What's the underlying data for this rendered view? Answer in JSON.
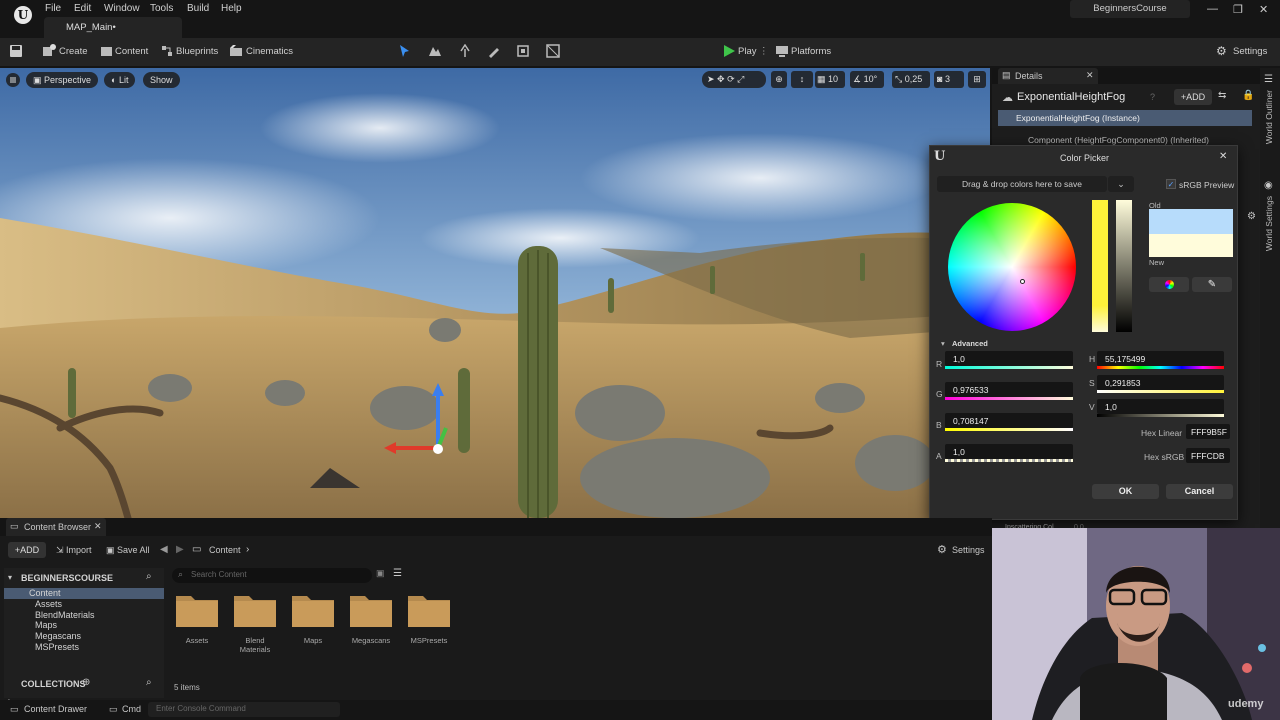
{
  "app": {
    "logo": "U",
    "project": "BeginnersCourse",
    "map_tab": "MAP_Main•"
  },
  "menu": [
    "File",
    "Edit",
    "Window",
    "Tools",
    "Build",
    "Help"
  ],
  "window_controls": [
    "—",
    "❐",
    "✕"
  ],
  "toolbar": {
    "create": "Create",
    "content": "Content",
    "blueprints": "Blueprints",
    "cinematics": "Cinematics",
    "play": "Play",
    "platforms": "Platforms",
    "settings": "Settings"
  },
  "viewport": {
    "perspective": "Perspective",
    "lit": "Lit",
    "show": "Show",
    "grid": "10",
    "angle": "10°",
    "scale": "0,25",
    "camera": "3"
  },
  "details": {
    "tab": "Details",
    "actor": "ExponentialHeightFog",
    "add": "ADD",
    "instance": "ExponentialHeightFog (Instance)",
    "component": "Component (HeightFogComponent0) (Inherited)",
    "inscattering_label": "Inscattering Col",
    "inscattering_val": "0,0"
  },
  "side_tabs": {
    "outliner": "World Outliner",
    "world_settings": "World Settings"
  },
  "color_picker": {
    "title": "Color Picker",
    "drop_text": "Drag & drop colors here to save",
    "srgb_label": "sRGB Preview",
    "old_label": "Old",
    "new_label": "New",
    "advanced": "Advanced",
    "old_color": "#b7dcfb",
    "new_color": "#fffcdb",
    "r_label": "R",
    "r": "1,0",
    "g_label": "G",
    "g": "0,976533",
    "b_label": "B",
    "b": "0,708147",
    "a_label": "A",
    "a": "1,0",
    "h_label": "H",
    "h": "55,175499",
    "s_label": "S",
    "s": "0,291853",
    "v_label": "V",
    "v": "1,0",
    "hex_linear_label": "Hex Linear",
    "hex_linear": "FFF9B5F",
    "hex_srgb_label": "Hex sRGB",
    "hex_srgb": "FFFCDB",
    "ok": "OK",
    "cancel": "Cancel"
  },
  "content_browser": {
    "tab": "Content Browser",
    "add": "ADD",
    "import": "Import",
    "save_all": "Save All",
    "path": "Content",
    "settings": "Settings",
    "root": "BEGINNERSCOURSE",
    "search_placeholder": "Search Content",
    "tree": [
      "Content",
      "Assets",
      "BlendMaterials",
      "Maps",
      "Megascans",
      "MSPresets"
    ],
    "folders": [
      "Assets",
      "Blend\nMaterials",
      "Maps",
      "Megascans",
      "MSPresets"
    ],
    "collections": "COLLECTIONS",
    "items": "5 items"
  },
  "statusbar": {
    "drawer": "Content Drawer",
    "cmd": "Cmd",
    "console_placeholder": "Enter Console Command"
  },
  "webcam": {
    "watermark": "udemy"
  }
}
